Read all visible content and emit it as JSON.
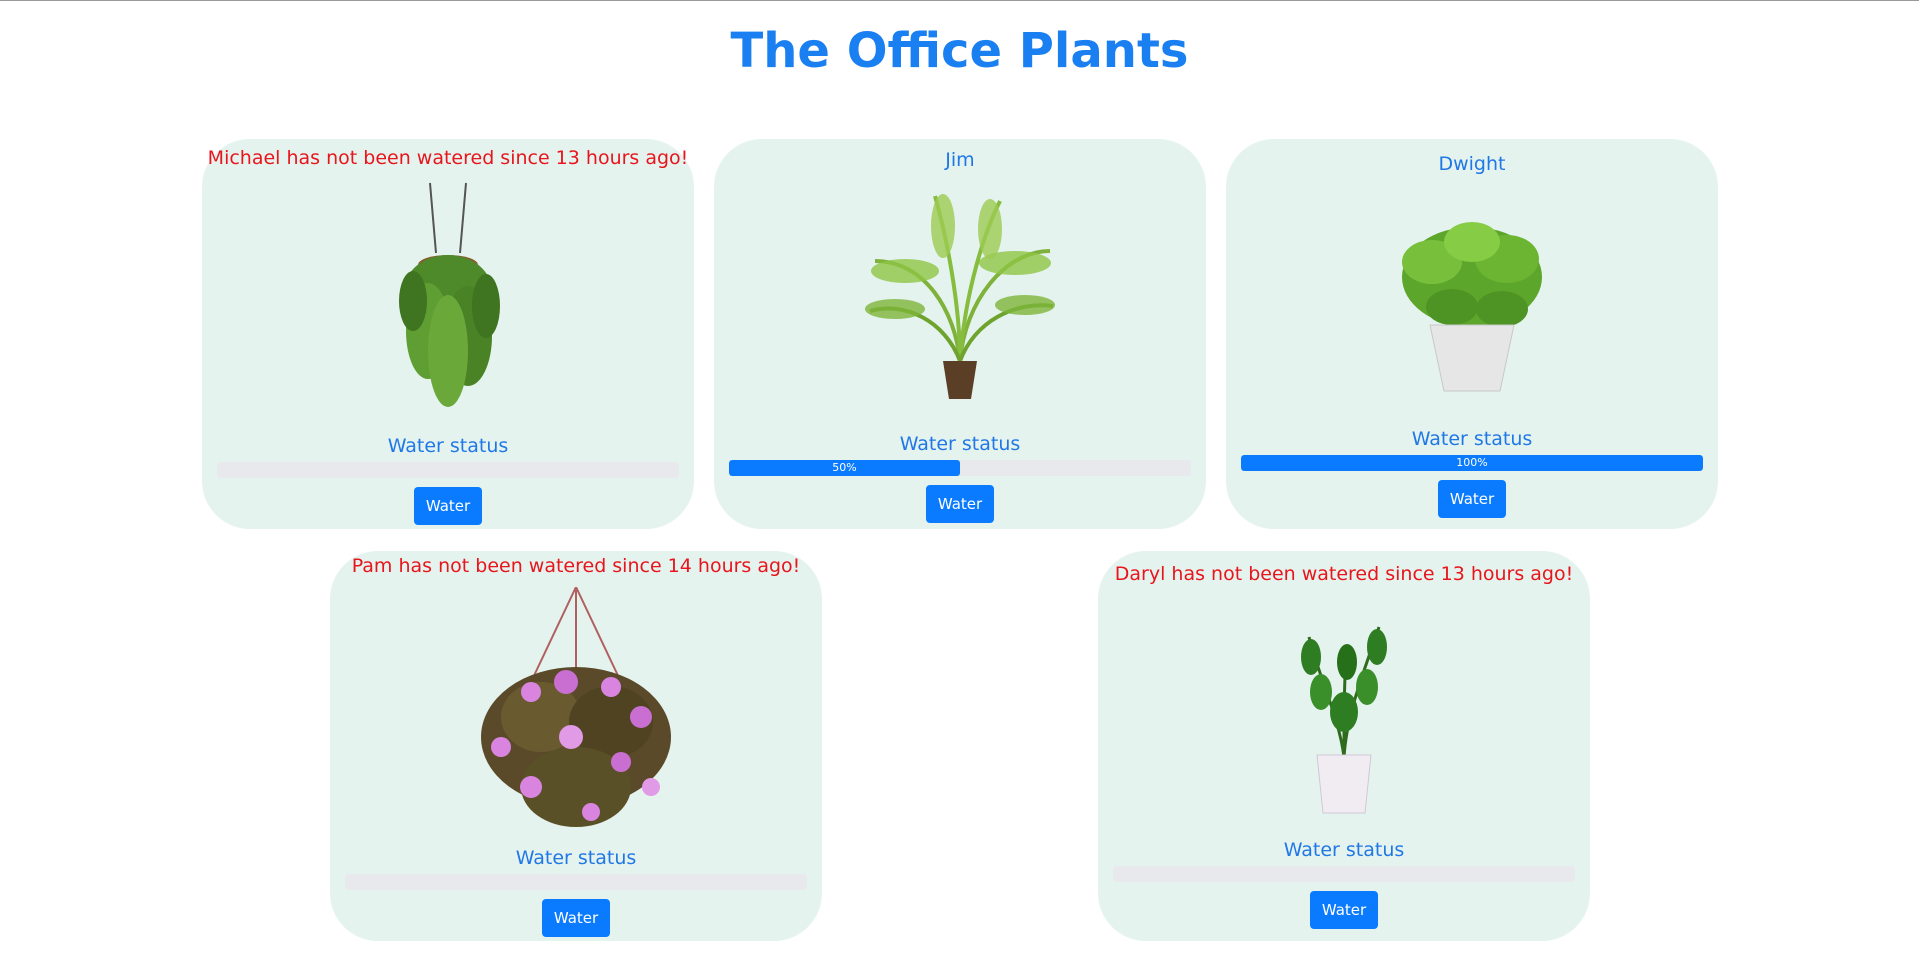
{
  "page": {
    "title": "The Office Plants"
  },
  "status_label": "Water status",
  "button_label": "Water",
  "colors": {
    "accent": "#0a7bff",
    "alert": "#e8151c",
    "card_bg": "#e5f3ef",
    "track": "#e8e9ec"
  },
  "plants": [
    {
      "header": "Michael has not been watered since 13 hours ago!",
      "alert": true,
      "water_level": 0,
      "level_label": "",
      "image": "hanging-fern-icon"
    },
    {
      "header": "Jim",
      "alert": false,
      "water_level": 50,
      "level_label": "50%",
      "image": "palm-plant-icon"
    },
    {
      "header": "Dwight",
      "alert": false,
      "water_level": 100,
      "level_label": "100%",
      "image": "potted-pothos-icon"
    },
    {
      "header": "Pam has not been watered since 14 hours ago!",
      "alert": true,
      "water_level": 0,
      "level_label": "",
      "image": "hanging-flower-basket-icon"
    },
    {
      "header": "Daryl has not been watered since 13 hours ago!",
      "alert": true,
      "water_level": 0,
      "level_label": "",
      "image": "zz-plant-icon"
    }
  ]
}
